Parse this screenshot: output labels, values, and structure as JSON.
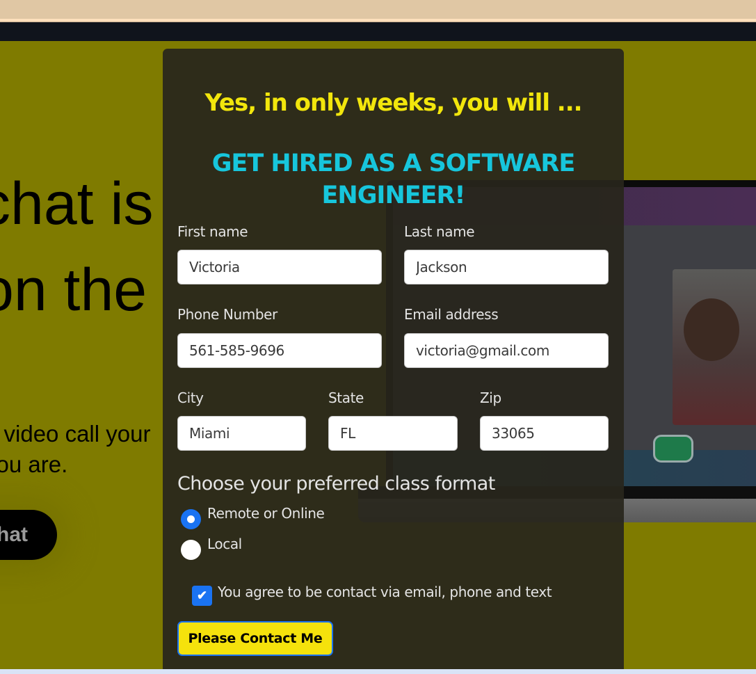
{
  "hero": {
    "title_line1": "chat is",
    "title_line2": "on the",
    "subtitle_line1": "d video call your",
    "subtitle_line2": "you are.",
    "cta_label": "hat"
  },
  "modal": {
    "heading": "Yes, in only weeks, you will ...",
    "subheading": "GET HIRED AS A SOFTWARE ENGINEER!",
    "fields": {
      "first_name": {
        "label": "First name",
        "value": "Victoria"
      },
      "last_name": {
        "label": "Last name",
        "value": "Jackson"
      },
      "phone": {
        "label": "Phone Number",
        "value": "561-585-9696"
      },
      "email": {
        "label": "Email address",
        "value": "victoria@gmail.com"
      },
      "city": {
        "label": "City",
        "value": "Miami"
      },
      "state": {
        "label": "State",
        "value": "FL"
      },
      "zip": {
        "label": "Zip",
        "value": "33065"
      }
    },
    "class_format": {
      "label": "Choose your preferred class format",
      "options": [
        {
          "label": "Remote or Online",
          "checked": true
        },
        {
          "label": "Local",
          "checked": false
        }
      ]
    },
    "consent": {
      "label": "You agree to be contact via email, phone and text",
      "checked": true
    },
    "submit_label": "Please Contact Me"
  },
  "colors": {
    "hero_bg": "#7f7b00",
    "heading_yellow": "#f2e60c",
    "subheading_cyan": "#17c6dc",
    "accent_blue": "#1a73f2",
    "button_yellow": "#f5e20c"
  }
}
